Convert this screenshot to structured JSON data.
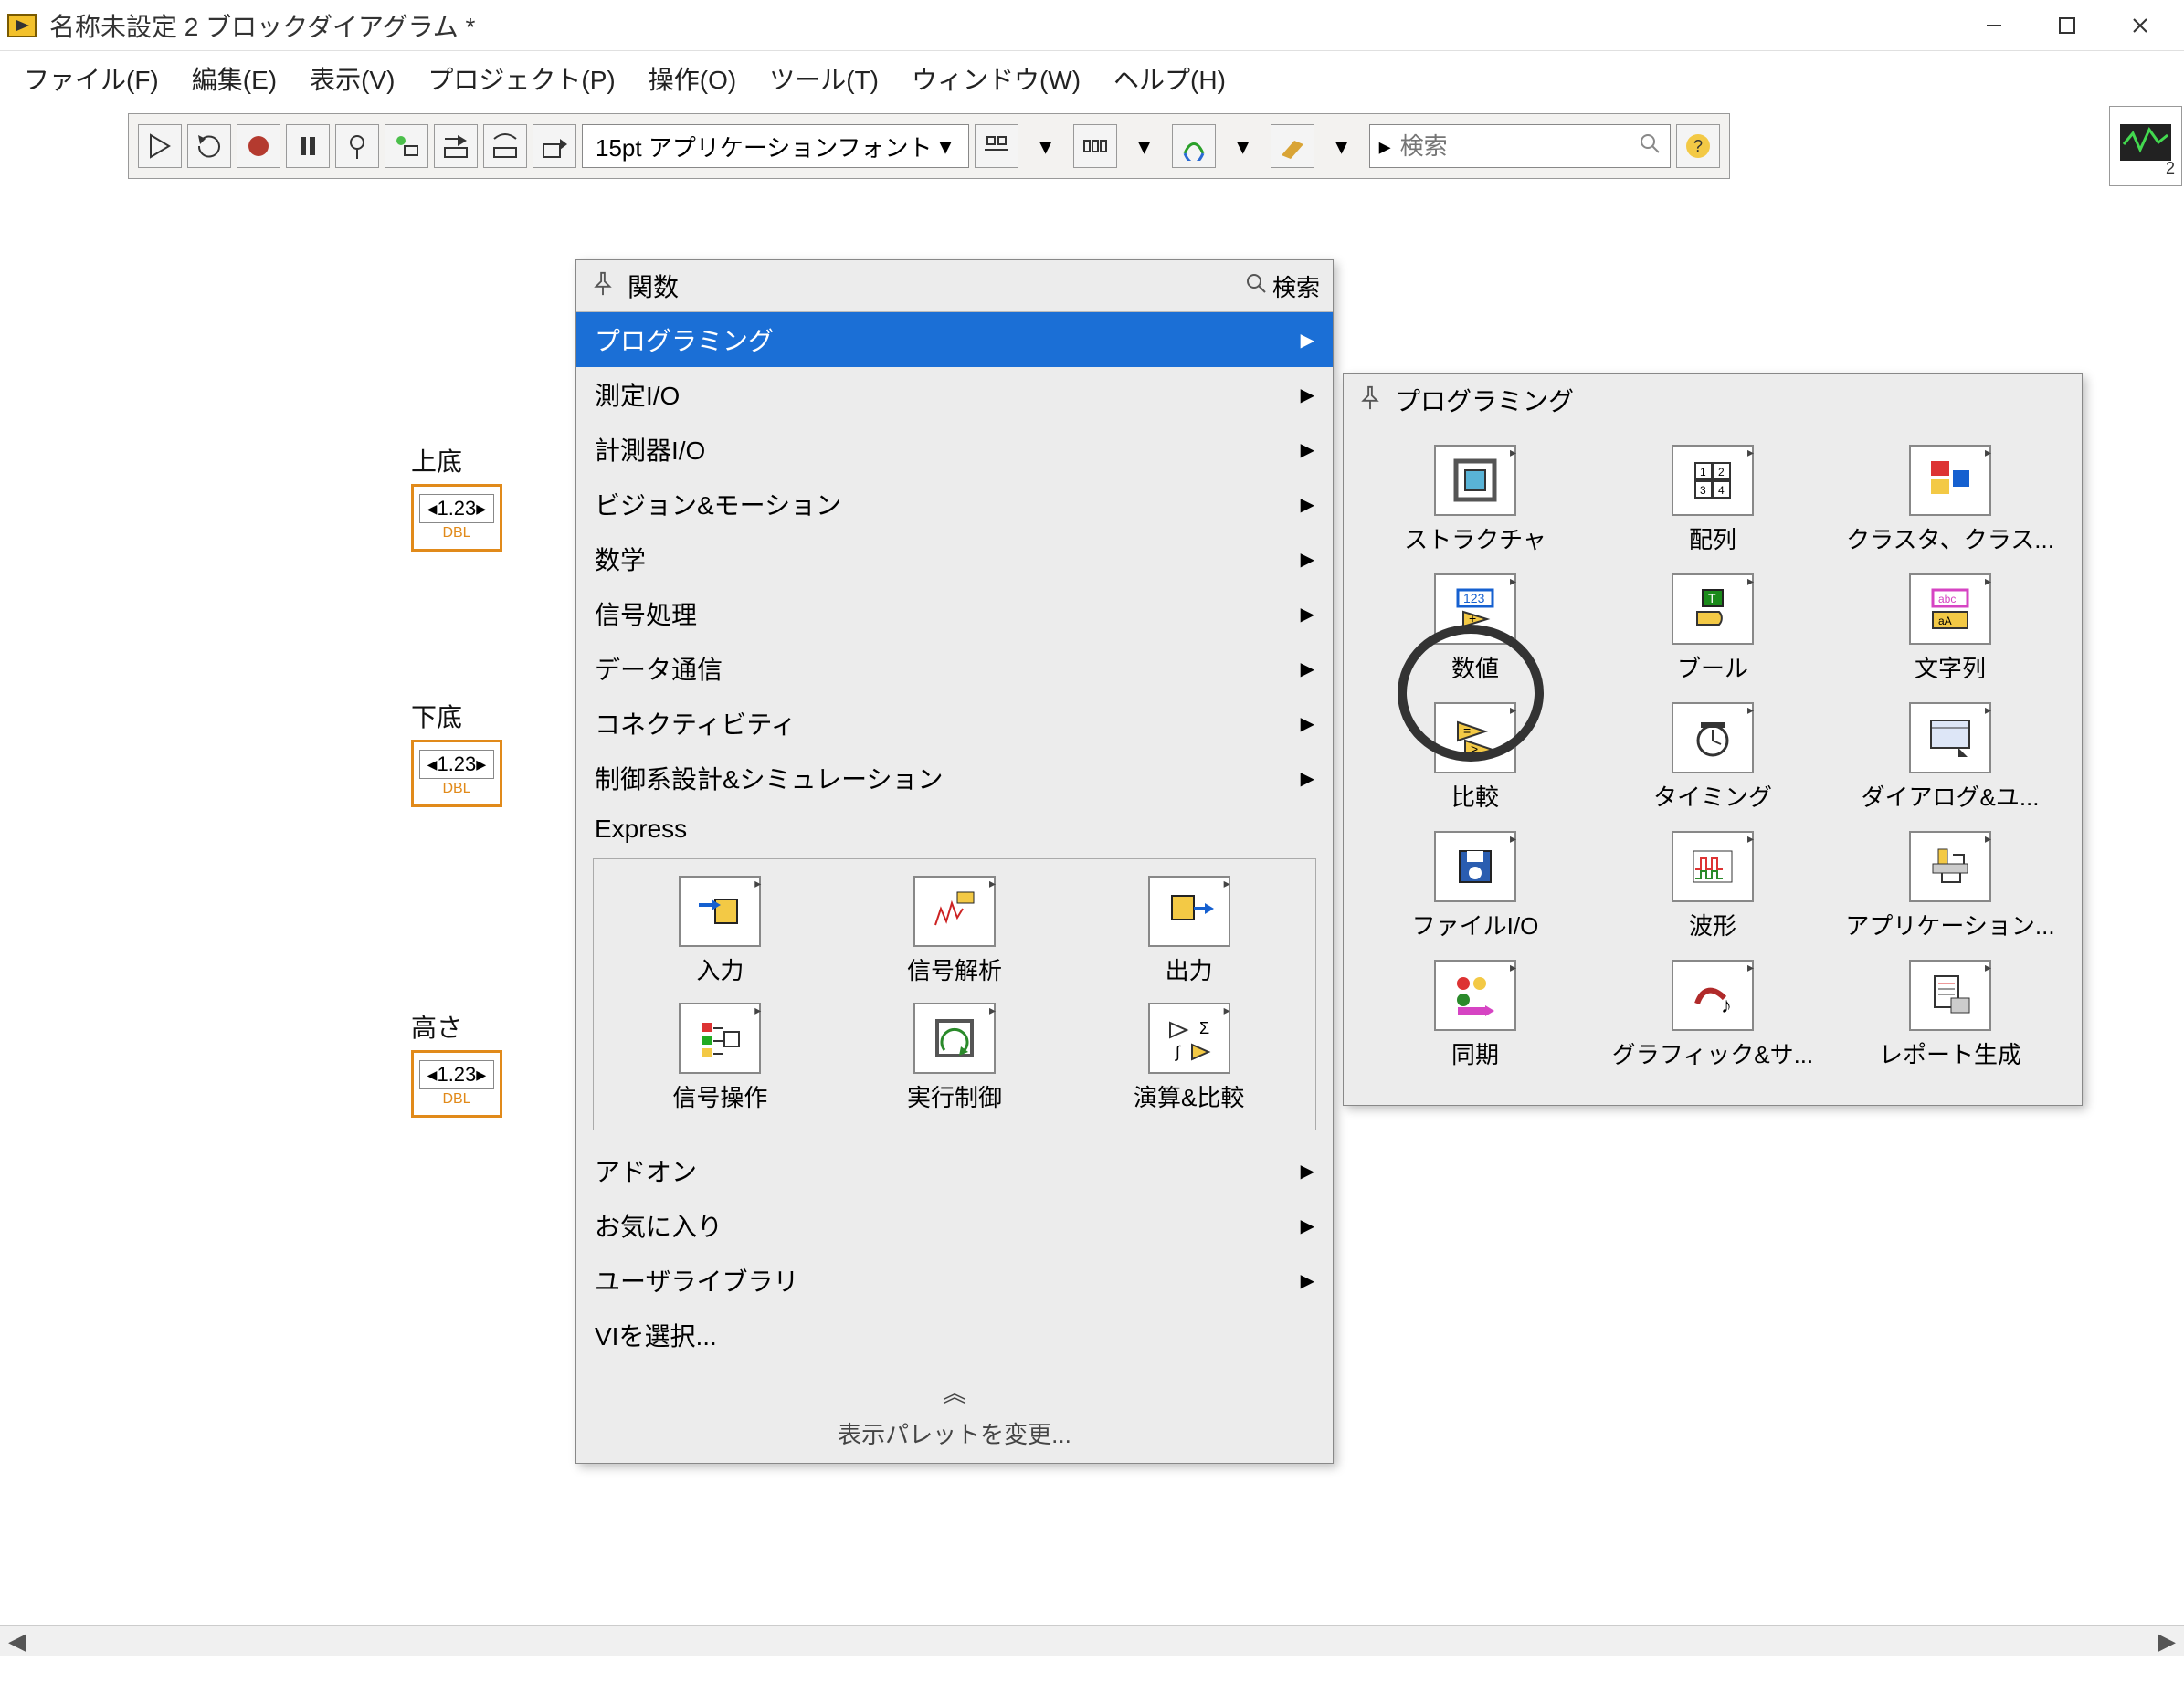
{
  "window": {
    "title": "名称未設定 2 ブロックダイアグラム *"
  },
  "menu": {
    "file": "ファイル(F)",
    "edit": "編集(E)",
    "view": "表示(V)",
    "project": "プロジェクト(P)",
    "operate": "操作(O)",
    "tools": "ツール(T)",
    "window": "ウィンドウ(W)",
    "help": "ヘルプ(H)"
  },
  "toolbar": {
    "font": "15pt アプリケーションフォント",
    "search_placeholder": "検索"
  },
  "terminals": [
    {
      "label": "上底",
      "value": "1.23",
      "type": "DBL"
    },
    {
      "label": "下底",
      "value": "1.23",
      "type": "DBL"
    },
    {
      "label": "高さ",
      "value": "1.23",
      "type": "DBL"
    }
  ],
  "palette_main": {
    "title": "関数",
    "search_label": "検索",
    "categories": [
      {
        "label": "プログラミング",
        "selected": true,
        "arrow": true
      },
      {
        "label": "測定I/O",
        "selected": false,
        "arrow": true
      },
      {
        "label": "計測器I/O",
        "selected": false,
        "arrow": true
      },
      {
        "label": "ビジョン&モーション",
        "selected": false,
        "arrow": true
      },
      {
        "label": "数学",
        "selected": false,
        "arrow": true
      },
      {
        "label": "信号処理",
        "selected": false,
        "arrow": true
      },
      {
        "label": "データ通信",
        "selected": false,
        "arrow": true
      },
      {
        "label": "コネクティビティ",
        "selected": false,
        "arrow": true
      },
      {
        "label": "制御系設計&シミュレーション",
        "selected": false,
        "arrow": true
      },
      {
        "label": "Express",
        "selected": false,
        "arrow": false
      }
    ],
    "express_items": [
      {
        "label": "入力"
      },
      {
        "label": "信号解析"
      },
      {
        "label": "出力"
      },
      {
        "label": "信号操作"
      },
      {
        "label": "実行制御"
      },
      {
        "label": "演算&比較"
      }
    ],
    "bottom": [
      {
        "label": "アドオン",
        "arrow": true
      },
      {
        "label": "お気に入り",
        "arrow": true
      },
      {
        "label": "ユーザライブラリ",
        "arrow": true
      },
      {
        "label": "VIを選択...",
        "arrow": false
      }
    ],
    "change_palette": "表示パレットを変更...",
    "chevrons": "︽"
  },
  "palette_prog": {
    "title": "プログラミング",
    "items": [
      {
        "label": "ストラクチャ"
      },
      {
        "label": "配列"
      },
      {
        "label": "クラスタ、クラス..."
      },
      {
        "label": "数値"
      },
      {
        "label": "ブール"
      },
      {
        "label": "文字列"
      },
      {
        "label": "比較"
      },
      {
        "label": "タイミング"
      },
      {
        "label": "ダイアログ&ユ..."
      },
      {
        "label": "ファイルI/O"
      },
      {
        "label": "波形"
      },
      {
        "label": "アプリケーション..."
      },
      {
        "label": "同期"
      },
      {
        "label": "グラフィック&サ..."
      },
      {
        "label": "レポート生成"
      }
    ]
  }
}
